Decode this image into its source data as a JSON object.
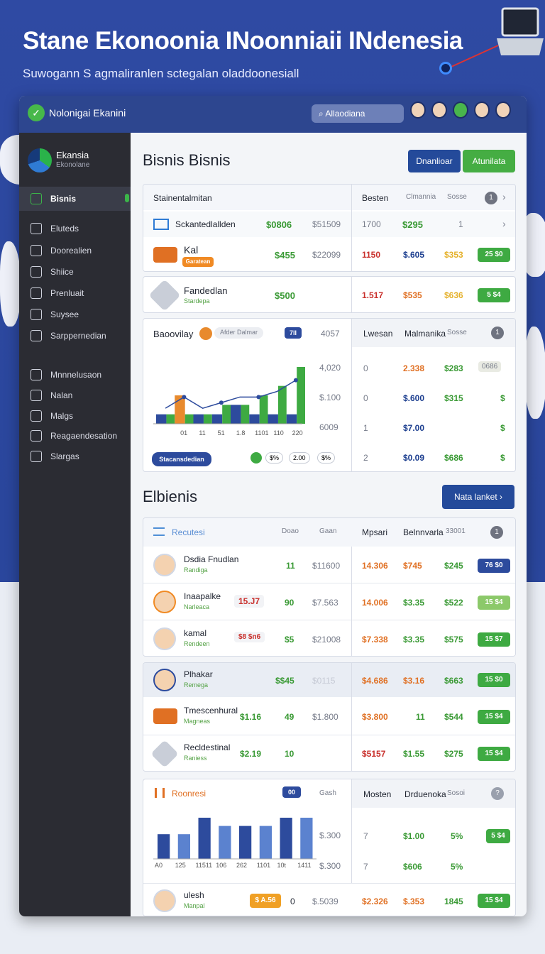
{
  "hero": {
    "title": "Stane Ekonoonia INoonniaii INdenesia",
    "subtitle": "Suwogann S agmaliranlen sctegalan oladdoonesiall"
  },
  "topbar": {
    "title": "Nolonigai Ekanini",
    "search_placeholder": "Allaodiana"
  },
  "sidebar": {
    "brand_title": "Ekansia",
    "brand_subtitle": "Ekonolane",
    "items": [
      {
        "label": "Bisnis",
        "active": true,
        "icon": "home-icon"
      },
      {
        "label": "Eluteds",
        "icon": "home-outline-icon"
      },
      {
        "label": "Doorealien",
        "icon": "person-icon"
      },
      {
        "label": "Shiice",
        "icon": "mail-icon"
      },
      {
        "label": "Prenluait",
        "icon": "gear-icon"
      },
      {
        "label": "Suysee",
        "icon": "mail-icon"
      },
      {
        "label": "Sarppernedian",
        "icon": "users-icon"
      },
      {
        "label": "Mnnnelusaon",
        "icon": "gear-icon"
      },
      {
        "label": "Nalan",
        "icon": "bookmark-icon"
      },
      {
        "label": "Malgs",
        "icon": "mail-icon"
      },
      {
        "label": "Reagaendesation",
        "icon": "archive-icon"
      },
      {
        "label": "Slargas",
        "icon": "bank-icon"
      }
    ]
  },
  "section1": {
    "title": "Bisnis Bisnis",
    "btn_primary": "Dnanlioar",
    "btn_secondary": "Atunilata",
    "header": {
      "left": "Stainentalmitan",
      "c1": "Besten",
      "c2": "Clmannia",
      "c3": "Sosse",
      "badge": "1"
    },
    "rows": [
      {
        "name": "Sckantedlallden",
        "v1": "$0806",
        "v2": "$51509",
        "v3": "1700",
        "v4": "$295",
        "v5": "1"
      },
      {
        "name": "Kal",
        "tag": "Garatean",
        "v1": "$455",
        "v2": "$22099",
        "v3": "1150",
        "v4": "$.605",
        "v5": "$353",
        "pill": "25 $0"
      },
      {
        "name": "Fandedlan",
        "sub": "Stardepa",
        "v1": "$500",
        "v3": "1.517",
        "v4": "$535",
        "v5": "$636",
        "pill": "5 $4"
      }
    ]
  },
  "chart1": {
    "legend_title": "Baoovilay",
    "filter": "Afder Dalmar",
    "badge": "7ll",
    "topvalue": "4057",
    "footer_tag": "Stacansdedian",
    "footer_v1": "$%",
    "footer_v2": "2.00",
    "footer_v3": "$%"
  },
  "chart_data": {
    "type": "bar",
    "categories": [
      "",
      "01",
      "11",
      "51",
      "1.8",
      "1101",
      "110",
      "220"
    ],
    "series": [
      {
        "values": [
          1,
          3,
          1,
          1,
          2,
          1,
          1,
          1
        ]
      },
      {
        "values": [
          1,
          1,
          1,
          2,
          2,
          3,
          4,
          6
        ]
      }
    ],
    "yticks": [
      "4,020",
      "$.100",
      "6009"
    ]
  },
  "side1": {
    "header": {
      "c1": "Lwesan",
      "c2": "Malmanika",
      "c3": "Sosse",
      "badge": "1"
    },
    "rows": [
      {
        "a": "0",
        "b": "2.338",
        "c": "$283",
        "d": "0686"
      },
      {
        "a": "0",
        "b": "$.600",
        "c": "$315",
        "d": "$"
      },
      {
        "a": "1",
        "b": "$7.00",
        "c": "",
        "d": "$"
      },
      {
        "a": "2",
        "b": "$0.09",
        "c": "$686",
        "d": "$"
      }
    ]
  },
  "section2": {
    "title": "Elbienis",
    "btn": "Nata lanket",
    "header": {
      "left": "Recutesi",
      "c1": "Doao",
      "c2": "Gaan",
      "c3": "Mpsari",
      "c4": "Belnnvarla",
      "c5": "33001",
      "badge": "1"
    },
    "rows": [
      {
        "name": "Dsdia Fnudlan",
        "sub": "Randiga",
        "v1": "11",
        "v2": "$11600",
        "v3": "14.306",
        "v4": "$745",
        "v5": "$245",
        "pill": "76 $0"
      },
      {
        "name": "Inaapalke",
        "sub": "Narleaca",
        "tag": "15.J7",
        "v1": "90",
        "v2": "$7.563",
        "v3": "14.006",
        "v4": "$3.35",
        "v5": "$522",
        "pill": "15 $4"
      },
      {
        "name": "kamal",
        "sub": "Rendeen",
        "tag": "$8 $n6",
        "v1": "$5",
        "v2": "$21008",
        "v3": "$7.338",
        "v4": "$3.35",
        "v5": "$575",
        "pill": "15 $7"
      },
      {
        "name": "Plhakar",
        "sub": "Remega",
        "v1": "$$45",
        "v2": "$0115",
        "v3": "$4.686",
        "v4": "$3.16",
        "v5": "$663",
        "pill": "15 $0"
      },
      {
        "name": "Tmescenhural",
        "sub": "Magneas",
        "v0": "$1.16",
        "v1": "49",
        "v2": "$1.800",
        "v3": "$3.800",
        "v4": "11",
        "v5": "$544",
        "pill": "15 $4"
      },
      {
        "name": "Recldestinal",
        "sub": "Raniess",
        "v0": "$2.19",
        "v1": "10",
        "v3": "$5157",
        "v4": "$1.55",
        "v5": "$275",
        "pill": "15 $4"
      }
    ]
  },
  "chart2": {
    "title": "Roonresi",
    "badge": "00",
    "label": "Gash",
    "xlabels": [
      "A0",
      "125",
      "11511",
      "106",
      "262",
      "1101",
      "10t",
      "1411"
    ],
    "values": [
      3,
      3,
      5,
      4,
      4,
      4,
      5,
      5
    ],
    "yticks": [
      "$.300",
      "$.300"
    ]
  },
  "side2": {
    "header": {
      "c1": "Mosten",
      "c2": "Drduenoka",
      "c3": "Sosoi",
      "badge": "?"
    },
    "rows": [
      {
        "a": "7",
        "b": "$1.00",
        "c": "5%",
        "pill": "5 $4"
      },
      {
        "a": "7",
        "b": "$606",
        "c": "5%"
      }
    ]
  },
  "last_row": {
    "name": "ulesh",
    "sub": "Manpal",
    "tag": "$ A.56",
    "v1": "0",
    "v2": "$.5039",
    "v3": "$2.326",
    "v4": "$.353",
    "v5": "1845",
    "pill": "15 $4"
  }
}
